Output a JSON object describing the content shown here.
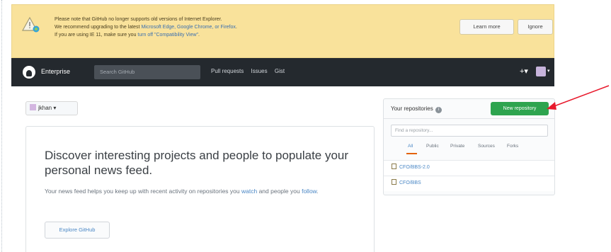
{
  "banner": {
    "line1": "Please note that GitHub no longer supports old versions of Internet Explorer.",
    "line2_prefix": "We recommend upgrading to the latest ",
    "line2_links": "Microsoft Edge, Google Chrome, or Firefox",
    "line2_suffix": ".",
    "line3_prefix": "If you are using IE 11, make sure you ",
    "line3_link": "turn off \"Compatibility View\"",
    "line3_suffix": ".",
    "learn_more": "Learn more",
    "ignore": "Ignore"
  },
  "header": {
    "brand": "Enterprise",
    "search_placeholder": "Search GitHub",
    "nav": [
      "Pull requests",
      "Issues",
      "Gist"
    ],
    "plus": "+▾",
    "caret": "▾"
  },
  "context": {
    "user": "jkhan",
    "caret": "▾"
  },
  "feed": {
    "heading": "Discover interesting projects and people to populate your personal news feed.",
    "text_prefix": "Your news feed helps you keep up with recent activity on repositories you ",
    "watch_link": "watch",
    "text_mid": " and people you ",
    "follow_link": "follow",
    "text_suffix": ".",
    "explore": "Explore GitHub"
  },
  "repos": {
    "title": "Your repositories",
    "info": "i",
    "new_repo": "New repository",
    "find_placeholder": "Find a repository...",
    "filters": [
      "All",
      "Public",
      "Private",
      "Sources",
      "Forks"
    ],
    "items": [
      "CFO/BBS-2.0",
      "CFO/BBS"
    ]
  },
  "colors": {
    "new_repo": "#2ea44f",
    "header": "#24292e",
    "banner": "#f9e29b",
    "arrow": "#e8192c"
  }
}
